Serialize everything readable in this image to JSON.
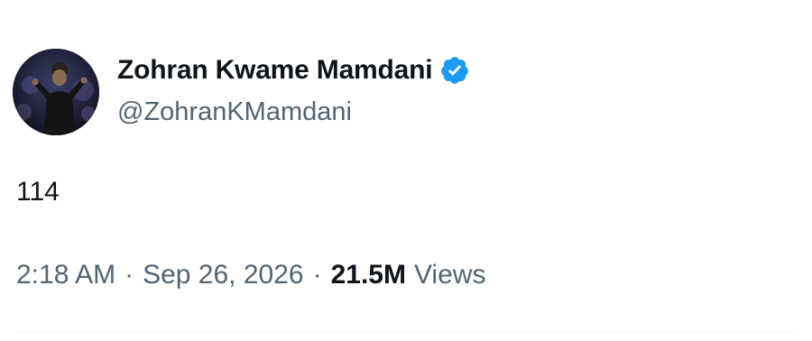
{
  "author": {
    "display_name": "Zohran Kwame Mamdani",
    "handle": "@ZohranKMamdani",
    "verified_icon": "verified-badge-icon",
    "verified_color": "#1d9bf0"
  },
  "tweet": {
    "text": "114"
  },
  "meta": {
    "time": "2:18 AM",
    "separator": "·",
    "date": "Sep 26, 2026",
    "views_count": "21.5M",
    "views_label": "Views"
  },
  "colors": {
    "primary_text": "#0f1419",
    "secondary_text": "#536471",
    "divider": "#eff3f4"
  }
}
